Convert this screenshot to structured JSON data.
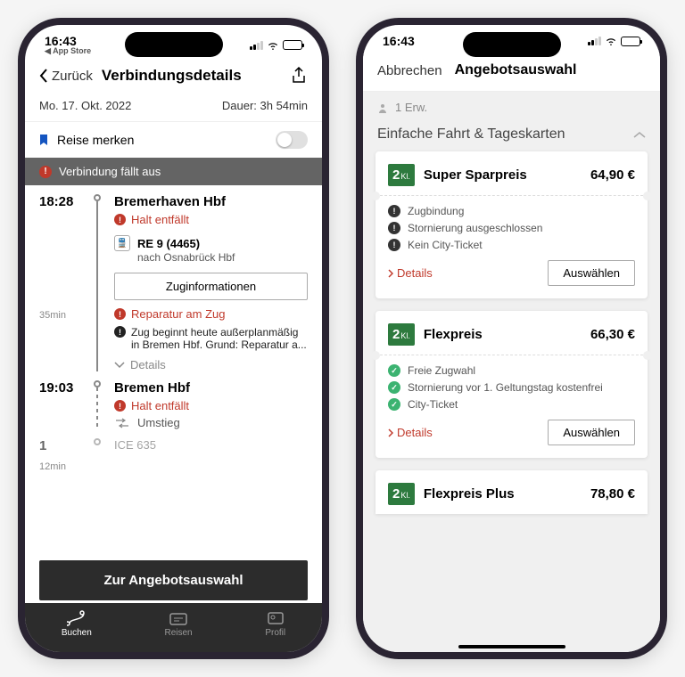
{
  "status": {
    "time": "16:43",
    "back_app": "◀ App Store"
  },
  "p1": {
    "nav": {
      "back": "Zurück",
      "title": "Verbindungsdetails"
    },
    "date": "Mo. 17. Okt. 2022",
    "duration_label": "Dauer: 3h 54min",
    "bookmark": "Reise merken",
    "alert": "Verbindung fällt aus",
    "stop1": {
      "time": "18:28",
      "station": "Bremerhaven Hbf",
      "warn": "Halt entfällt",
      "train_id": "RE 9 (4465)",
      "train_dest": "nach Osnabrück Hbf",
      "info_btn": "Zuginformationen",
      "repair": "Reparatur am Zug",
      "note": "Zug beginnt heute außerplanmäßig in Bremen Hbf. Grund: Reparatur a...",
      "details": "Details",
      "leg_dur": "35min"
    },
    "stop2": {
      "time": "19:03",
      "station": "Bremen Hbf",
      "warn": "Halt entfällt",
      "transfer": "Umstieg",
      "leg_dur": "12min"
    },
    "peek_time": "1",
    "peek_train": "ICE 635",
    "cta": "Zur Angebotsauswahl",
    "tabs": {
      "buchen": "Buchen",
      "reisen": "Reisen",
      "profil": "Profil"
    }
  },
  "p2": {
    "sheet": {
      "cancel": "Abbrechen",
      "title": "Angebotsauswahl"
    },
    "pax": "1 Erw.",
    "section": "Einfache Fahrt & Tageskarten",
    "class_label": "Kl.",
    "fare1": {
      "name": "Super Sparpreis",
      "price": "64,90 €",
      "b1": "Zugbindung",
      "b2": "Stornierung ausgeschlossen",
      "b3": "Kein City-Ticket",
      "details": "Details",
      "select": "Auswählen"
    },
    "fare2": {
      "name": "Flexpreis",
      "price": "66,30 €",
      "b1": "Freie Zugwahl",
      "b2": "Stornierung vor 1. Geltungstag kostenfrei",
      "b3": "City-Ticket",
      "details": "Details",
      "select": "Auswählen"
    },
    "fare3": {
      "name": "Flexpreis Plus",
      "price": "78,80 €"
    }
  }
}
